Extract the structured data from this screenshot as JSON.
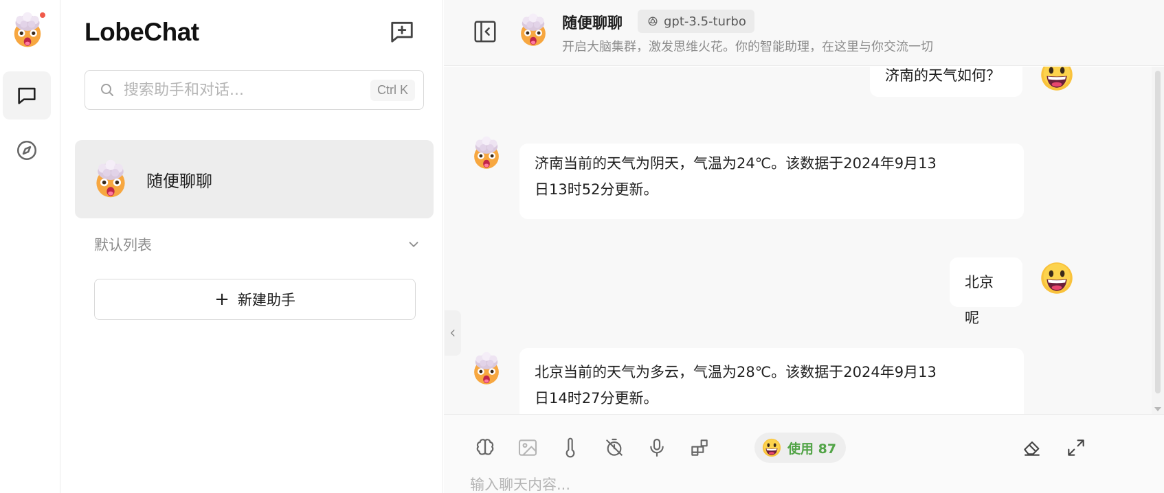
{
  "colors": {
    "accent_dot": "#f05a4a",
    "usage_green": "#52a447",
    "bubble_bg": "#ffffff",
    "chat_bg": "#f8f8f8",
    "active_session_bg": "#ededed"
  },
  "icons": {
    "rail": [
      "chat-bubble-icon",
      "compass-icon"
    ],
    "toolbar": [
      "brain-icon",
      "image-icon",
      "thermometer-icon",
      "timer-off-icon",
      "microphone-icon",
      "plugin-blocks-icon",
      "eraser-icon",
      "expand-icon"
    ]
  },
  "sidebar": {
    "logo": "LobeChat",
    "search_placeholder": "搜索助手和对话...",
    "search_shortcut": "Ctrl K",
    "session": {
      "title": "随便聊聊"
    },
    "group_label": "默认列表",
    "new_agent_label": "新建助手"
  },
  "header": {
    "title": "随便聊聊",
    "model": "gpt-3.5-turbo",
    "description": "开启大脑集群，激发思维火花。你的智能助理，在这里与你交流一切"
  },
  "messages": [
    {
      "role": "user",
      "lines": [
        "济南的天气如何？"
      ]
    },
    {
      "role": "assistant",
      "lines": [
        "济南当前的天气为阴天，气温为24℃。该数据于2024年9月13",
        "日13时52分更新。"
      ]
    },
    {
      "role": "user",
      "lines": [
        "北京呢"
      ]
    },
    {
      "role": "assistant",
      "lines": [
        "北京当前的天气为多云，气温为28℃。该数据于2024年9月13",
        "日14时27分更新。"
      ]
    }
  ],
  "input": {
    "usage_label": "使用 87",
    "placeholder": "输入聊天内容..."
  }
}
